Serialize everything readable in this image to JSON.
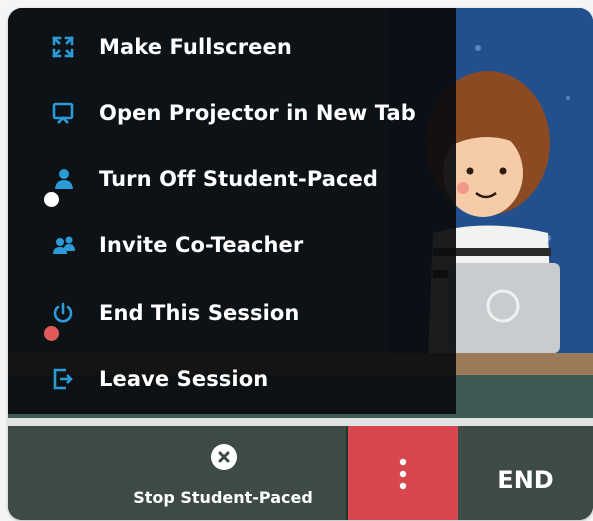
{
  "menu": {
    "items": [
      {
        "label": "Make Fullscreen",
        "icon": "fullscreen-icon"
      },
      {
        "label": "Open Projector in New Tab",
        "icon": "projector-icon"
      },
      {
        "label": "Turn Off Student-Paced",
        "icon": "student-icon"
      },
      {
        "label": "Invite Co-Teacher",
        "icon": "co-teacher-icon"
      },
      {
        "label": "End This Session",
        "icon": "power-icon"
      },
      {
        "label": "Leave Session",
        "icon": "exit-icon"
      }
    ]
  },
  "toolbar": {
    "stop_label": "Stop Student-Paced",
    "more_icon": "more-vertical-icon",
    "end_label": "END"
  },
  "colors": {
    "accent_blue": "#2b9bd8",
    "end_red": "#d7474d",
    "bar_bg": "#3d4a47",
    "status_dot_red": "#e05a5a"
  }
}
